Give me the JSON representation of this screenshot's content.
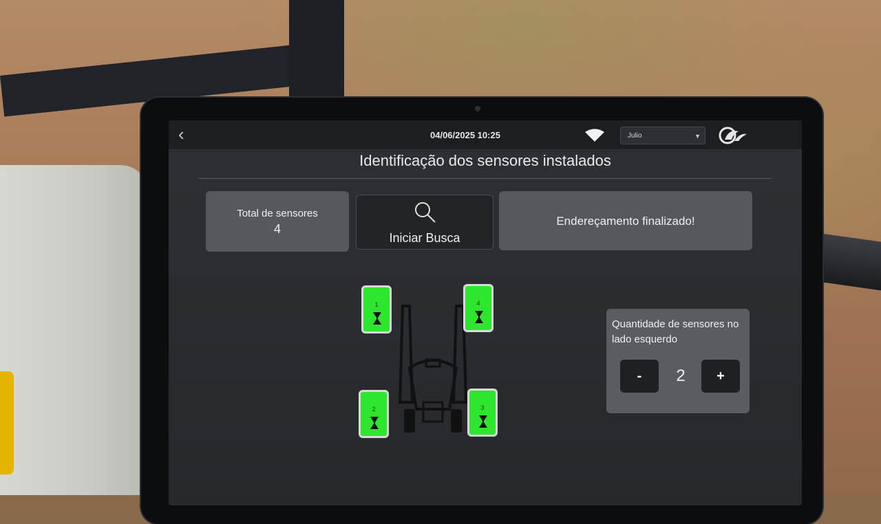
{
  "header": {
    "datetime": "04/06/2025 10:25",
    "user": "Julio"
  },
  "page": {
    "title": "Identificação dos sensores instalados"
  },
  "summary": {
    "total_label": "Total de sensores",
    "total_value": "4",
    "search_label": "Iniciar Busca",
    "status_text": "Endereçamento finalizado!"
  },
  "sensors": [
    {
      "number": "1",
      "color": "#2ee62e"
    },
    {
      "number": "2",
      "color": "#2ee62e"
    },
    {
      "number": "3",
      "color": "#2ee62e"
    },
    {
      "number": "4",
      "color": "#2ee62e"
    }
  ],
  "left_side": {
    "label": "Quantidade de sensores no lado esquerdo",
    "minus": "-",
    "value": "2",
    "plus": "+"
  },
  "icons": [
    "back-icon",
    "wifi-icon",
    "dropdown-caret-icon",
    "brand-logo-icon",
    "search-icon",
    "sprayer-icon",
    "nozzle-icon"
  ],
  "colors": {
    "sensor_ok": "#2ee62e",
    "screen_bg": "#2d3034",
    "card_bg": "#55585d"
  }
}
